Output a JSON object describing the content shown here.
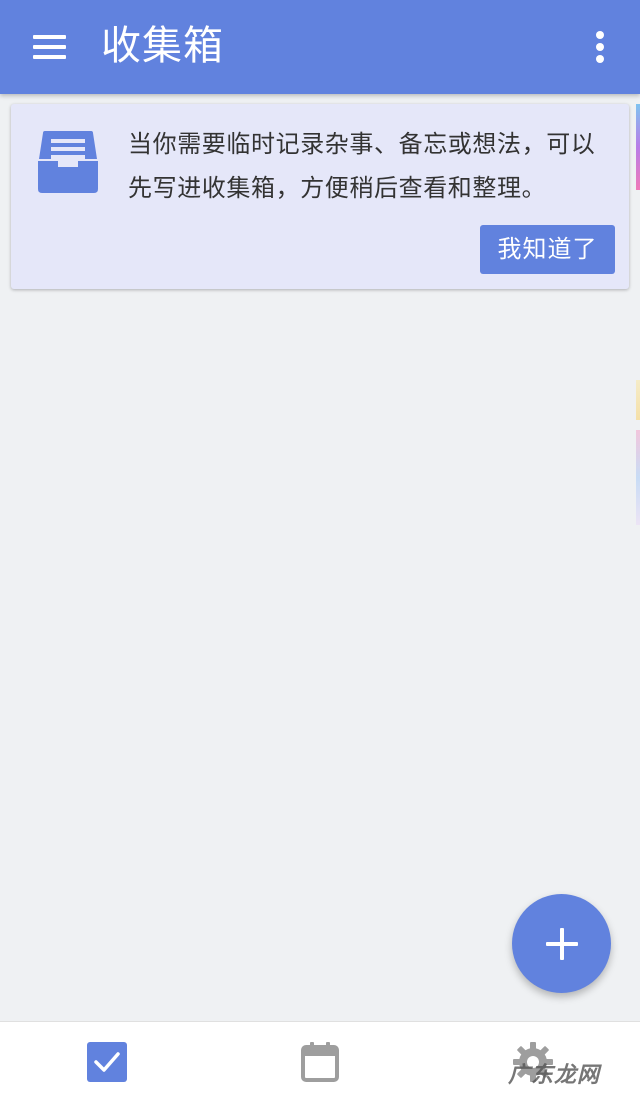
{
  "app_bar": {
    "title": "收集箱",
    "menu_icon": "hamburger-menu-icon",
    "overflow_icon": "more-vert-icon"
  },
  "tip_card": {
    "icon": "inbox-tray-icon",
    "message": "当你需要临时记录杂事、备忘或想法，可以先写进收集箱，方便稍后查看和整理。",
    "button_label": "我知道了"
  },
  "fab": {
    "icon": "plus-icon"
  },
  "bottom_nav": {
    "items": [
      {
        "icon": "checkbox-checked-icon",
        "selected": true
      },
      {
        "icon": "calendar-icon",
        "selected": false
      },
      {
        "icon": "settings-gear-icon",
        "selected": false
      }
    ]
  },
  "watermark": {
    "text": "广东龙网"
  },
  "colors": {
    "primary": "#6182de",
    "background": "#eff1f3",
    "card_background": "#e5e7f9",
    "inactive_icon": "#9e9e9e"
  }
}
